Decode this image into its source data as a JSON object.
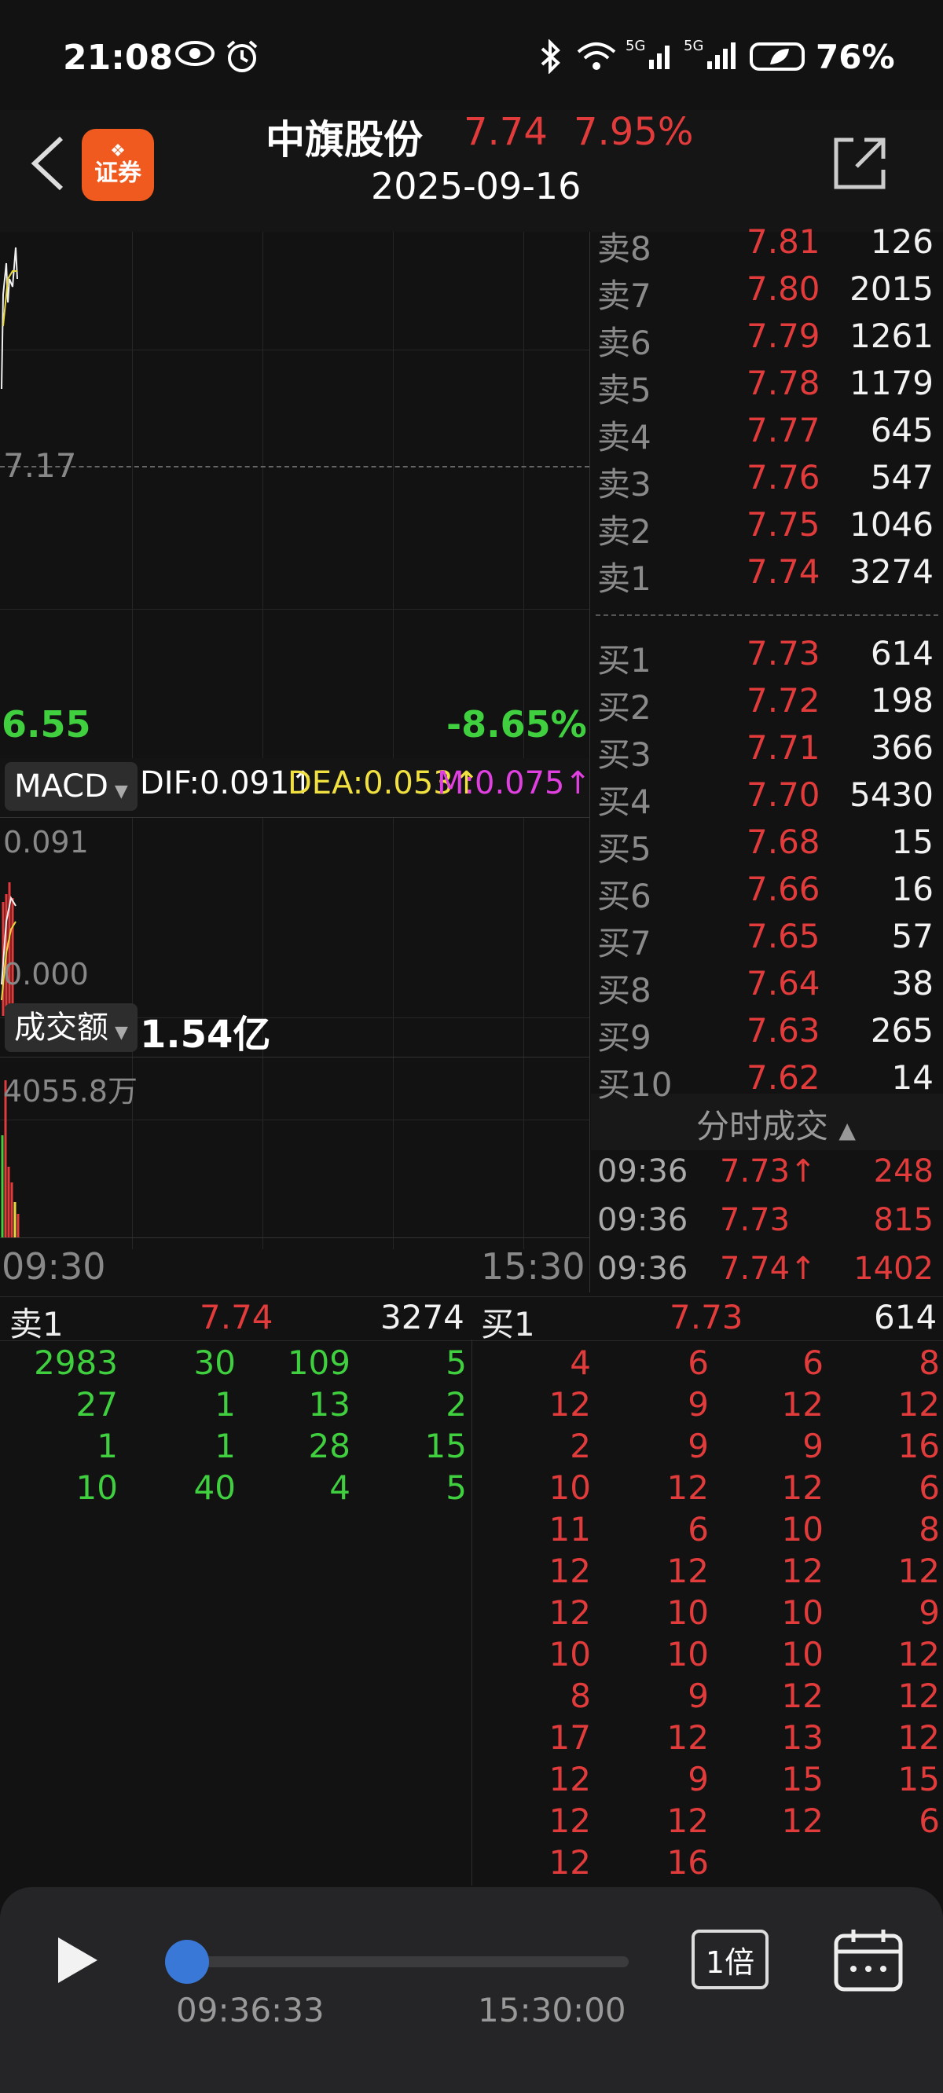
{
  "status": {
    "time": "21:08",
    "battery": "76%"
  },
  "header": {
    "name": "中旗股份",
    "price": "7.74",
    "change_pct": "7.95%",
    "date": "2025-09-16",
    "logo_text": "证券"
  },
  "chart": {
    "price_label": "7.17",
    "low_price": "6.55",
    "low_pct": "-8.65%",
    "macd": {
      "selector": "MACD",
      "dif": "DIF:0.091↑",
      "dea": "DEA:0.053↑",
      "m": "M:0.075↑",
      "top": "0.091",
      "zero": "0.000"
    },
    "volume": {
      "selector": "成交额",
      "value": "1.54亿",
      "top": "4055.8万"
    },
    "time_start": "09:30",
    "time_end": "15:30"
  },
  "order_book": {
    "asks": [
      {
        "label": "卖8",
        "price": "7.81",
        "qty": "126"
      },
      {
        "label": "卖7",
        "price": "7.80",
        "qty": "2015"
      },
      {
        "label": "卖6",
        "price": "7.79",
        "qty": "1261"
      },
      {
        "label": "卖5",
        "price": "7.78",
        "qty": "1179"
      },
      {
        "label": "卖4",
        "price": "7.77",
        "qty": "645"
      },
      {
        "label": "卖3",
        "price": "7.76",
        "qty": "547"
      },
      {
        "label": "卖2",
        "price": "7.75",
        "qty": "1046"
      },
      {
        "label": "卖1",
        "price": "7.74",
        "qty": "3274"
      }
    ],
    "bids": [
      {
        "label": "买1",
        "price": "7.73",
        "qty": "614"
      },
      {
        "label": "买2",
        "price": "7.72",
        "qty": "198"
      },
      {
        "label": "买3",
        "price": "7.71",
        "qty": "366"
      },
      {
        "label": "买4",
        "price": "7.70",
        "qty": "5430"
      },
      {
        "label": "买5",
        "price": "7.68",
        "qty": "15"
      },
      {
        "label": "买6",
        "price": "7.66",
        "qty": "16"
      },
      {
        "label": "买7",
        "price": "7.65",
        "qty": "57"
      },
      {
        "label": "买8",
        "price": "7.64",
        "qty": "38"
      },
      {
        "label": "买9",
        "price": "7.63",
        "qty": "265"
      },
      {
        "label": "买10",
        "price": "7.62",
        "qty": "14"
      }
    ]
  },
  "ticks": {
    "title": "分时成交",
    "rows": [
      {
        "time": "09:36",
        "price": "7.73↑",
        "vol": "248"
      },
      {
        "time": "09:36",
        "price": "7.73",
        "vol": "815"
      },
      {
        "time": "09:36",
        "price": "7.74↑",
        "vol": "1402"
      }
    ]
  },
  "queue": {
    "sell": {
      "label": "卖1",
      "price": "7.74",
      "qty": "3274",
      "rows": [
        [
          "2983",
          "30",
          "109",
          "5"
        ],
        [
          "27",
          "1",
          "13",
          "2"
        ],
        [
          "1",
          "1",
          "28",
          "15"
        ],
        [
          "10",
          "40",
          "4",
          "5"
        ]
      ]
    },
    "buy": {
      "label": "买1",
      "price": "7.73",
      "qty": "614",
      "rows": [
        [
          "4",
          "6",
          "6",
          "8"
        ],
        [
          "12",
          "9",
          "12",
          "12"
        ],
        [
          "2",
          "9",
          "9",
          "16"
        ],
        [
          "10",
          "12",
          "12",
          "6"
        ],
        [
          "11",
          "6",
          "10",
          "8"
        ],
        [
          "12",
          "12",
          "12",
          "12"
        ],
        [
          "12",
          "10",
          "10",
          "9"
        ],
        [
          "10",
          "10",
          "10",
          "12"
        ],
        [
          "8",
          "9",
          "12",
          "12"
        ],
        [
          "17",
          "12",
          "13",
          "12"
        ],
        [
          "12",
          "9",
          "15",
          "15"
        ],
        [
          "12",
          "12",
          "12",
          "6"
        ],
        [
          "12",
          "16"
        ]
      ]
    }
  },
  "player": {
    "current": "09:36:33",
    "end": "15:30:00",
    "speed": "1倍",
    "progress": 0.0
  }
}
